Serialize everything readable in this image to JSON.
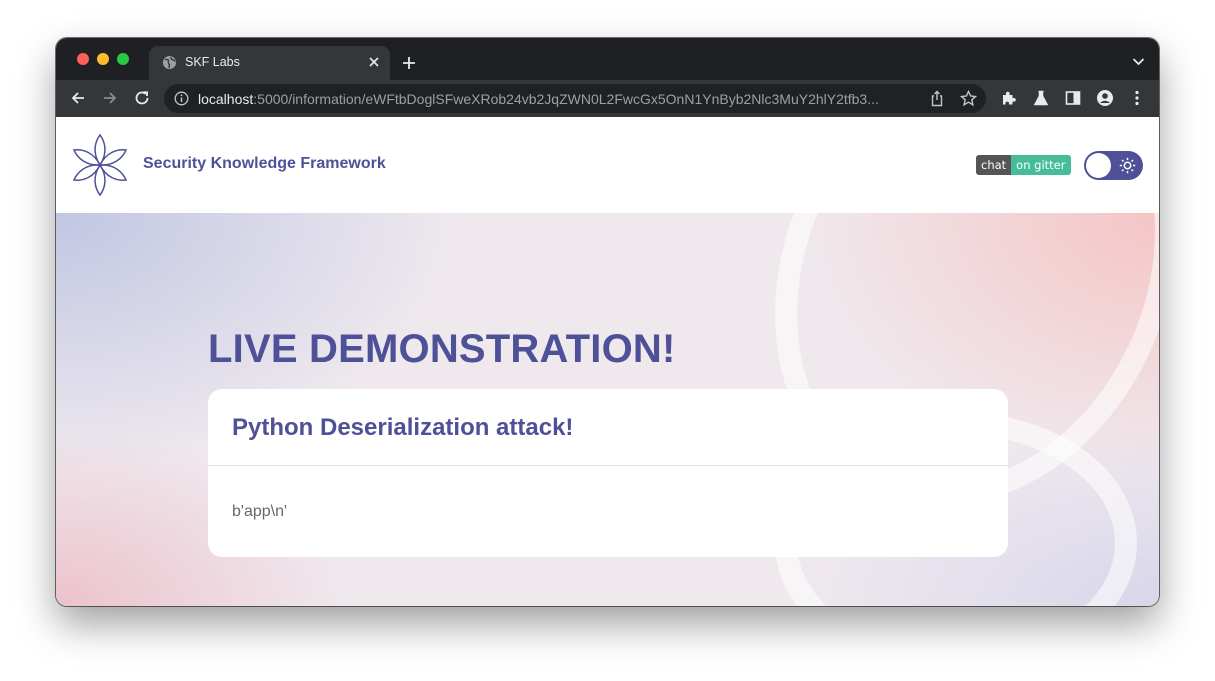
{
  "browser": {
    "tab": {
      "title": "SKF Labs",
      "icon": "globe-icon"
    },
    "address_bar": {
      "host": "localhost",
      "path": ":5000/information/eWFtbDoglSFweXRob24vb2JqZWN0L2FwcGx5OnN1YnByb2Nlc3MuY2hlY2tfb3..."
    },
    "colors": {
      "tabstrip": "#1f2023",
      "toolbar": "#35363a",
      "omnibox": "#202124"
    }
  },
  "site": {
    "brand_name": "Security Knowledge Framework",
    "logo": "flower-logo-icon",
    "gitter_badge": {
      "left": "chat",
      "right": "on gitter"
    },
    "theme_toggle": {
      "icon": "sun-icon",
      "state": "light"
    },
    "colors": {
      "accent": "#4e5197",
      "badge_left": "#555555",
      "badge_right": "#46bc99"
    }
  },
  "hero": {
    "heading": "LIVE DEMONSTRATION!",
    "card": {
      "title": "Python Deserialization attack!",
      "body": "b'app\\n'"
    }
  }
}
